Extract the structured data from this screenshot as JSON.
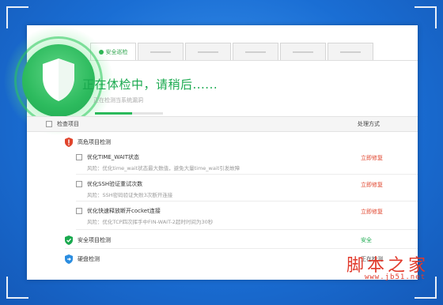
{
  "tabs": [
    {
      "label": "安全巡检"
    },
    {
      "label": ""
    },
    {
      "label": ""
    },
    {
      "label": ""
    },
    {
      "label": ""
    },
    {
      "label": ""
    }
  ],
  "status": {
    "title": "正在体检中，请稍后......",
    "subtitle": "正在检测当系统漏洞",
    "progress": 0.55
  },
  "table": {
    "col_item": "检查项目",
    "col_action": "处理方式"
  },
  "sections": {
    "danger": {
      "label": "高危项目检测"
    },
    "safe": {
      "label": "安全项目检测",
      "action": "安全"
    },
    "disk": {
      "label": "硬盘检测",
      "action": "正在检测"
    }
  },
  "items": [
    {
      "title": "优化TIME_WAIT状态",
      "risk": "风险：优化time_wait状态最大数值，避免大量time_wait引发故障",
      "action": "立即修复"
    },
    {
      "title": "优化SSH验证重试次数",
      "risk": "风险：SSH密码验证失败3次断开连接",
      "action": "立即修复"
    },
    {
      "title": "优化快速释放断开cocket连接",
      "risk": "风险：优化TCP四次挥手中FIN-WAIT-2超时时间为30秒",
      "action": "立即修复"
    }
  ],
  "watermark": {
    "text": "脚本之家",
    "url": "www.jb51.net"
  },
  "colors": {
    "accent_green": "#19a94e",
    "danger_red": "#e0442c",
    "background_blue": "#1a6ed4",
    "safe_blue": "#2b8de0"
  }
}
